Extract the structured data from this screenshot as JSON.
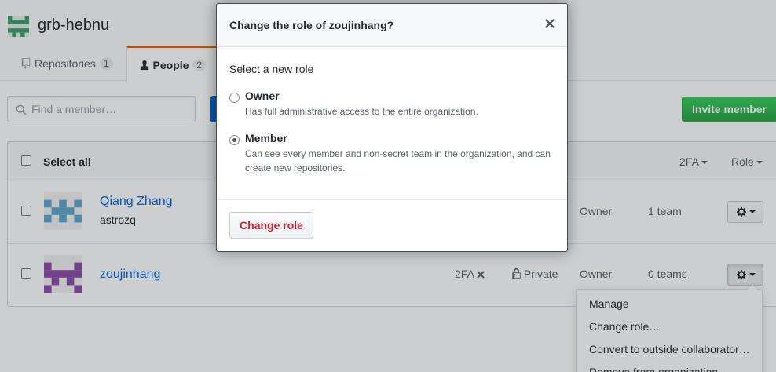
{
  "org": {
    "name": "grb-hebnu",
    "logo_color": "#3b9e6b"
  },
  "tabs": [
    {
      "label": "Repositories",
      "count": "1",
      "icon": "repo-icon"
    },
    {
      "label": "People",
      "count": "2",
      "icon": "person-icon"
    }
  ],
  "search": {
    "placeholder": "Find a member…",
    "value": ""
  },
  "invite_button": "Invite member",
  "table": {
    "select_all": "Select all",
    "filter_2fa": "2FA",
    "filter_role": "Role",
    "members": [
      {
        "name": "Qiang Zhang",
        "login": "astrozq",
        "role": "Owner",
        "teams": "1 team",
        "avatar_color": "#5fa6c9"
      },
      {
        "name": "zoujinhang",
        "login": "",
        "twofa": "2FA",
        "visibility": "Private",
        "role": "Owner",
        "teams": "0 teams",
        "avatar_color": "#8c4aa8"
      }
    ]
  },
  "menu": {
    "items": [
      "Manage",
      "Change role…",
      "Convert to outside collaborator…",
      "Remove from organization"
    ]
  },
  "modal": {
    "title": "Change the role of zoujinhang?",
    "prompt": "Select a new role",
    "options": [
      {
        "label": "Owner",
        "description": "Has full administrative access to the entire organization.",
        "checked": false
      },
      {
        "label": "Member",
        "description": "Can see every member and non-secret team in the organization, and can create new repositories.",
        "checked": true
      }
    ],
    "submit": "Change role",
    "danger_color": "#cb2431"
  },
  "colors": {
    "accent": "#0366d6",
    "success": "#28a745",
    "tab_active": "#e36209"
  }
}
